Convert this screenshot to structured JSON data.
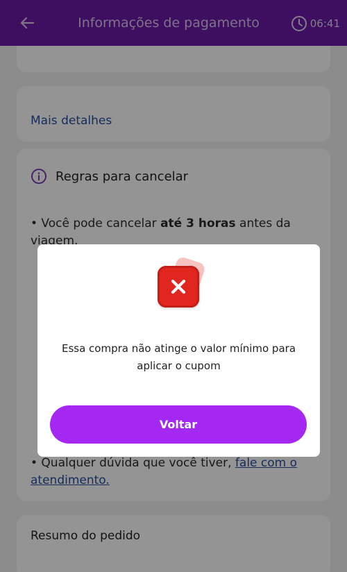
{
  "header": {
    "title": "Informações de pagamento",
    "timer": "06:41",
    "background": "#6b1aa8"
  },
  "details": {
    "link": "Mais detalhes"
  },
  "rules": {
    "title": "Regras para cancelar",
    "rule1_prefix": "• Você pode cancelar ",
    "rule1_bold": "até 3 horas",
    "rule1_suffix": " antes da viagem.",
    "last_prefix": "• Qualquer dúvida que você tiver, ",
    "last_link": "fale com o atendimento."
  },
  "summary": {
    "title": "Resumo do pedido"
  },
  "modal": {
    "icon": "error-x-icon",
    "message": "Essa compra não atinge o valor mínimo para aplicar o cupom",
    "button_label": "Voltar",
    "accent": "#a428f2",
    "error_color": "#e0261f"
  }
}
